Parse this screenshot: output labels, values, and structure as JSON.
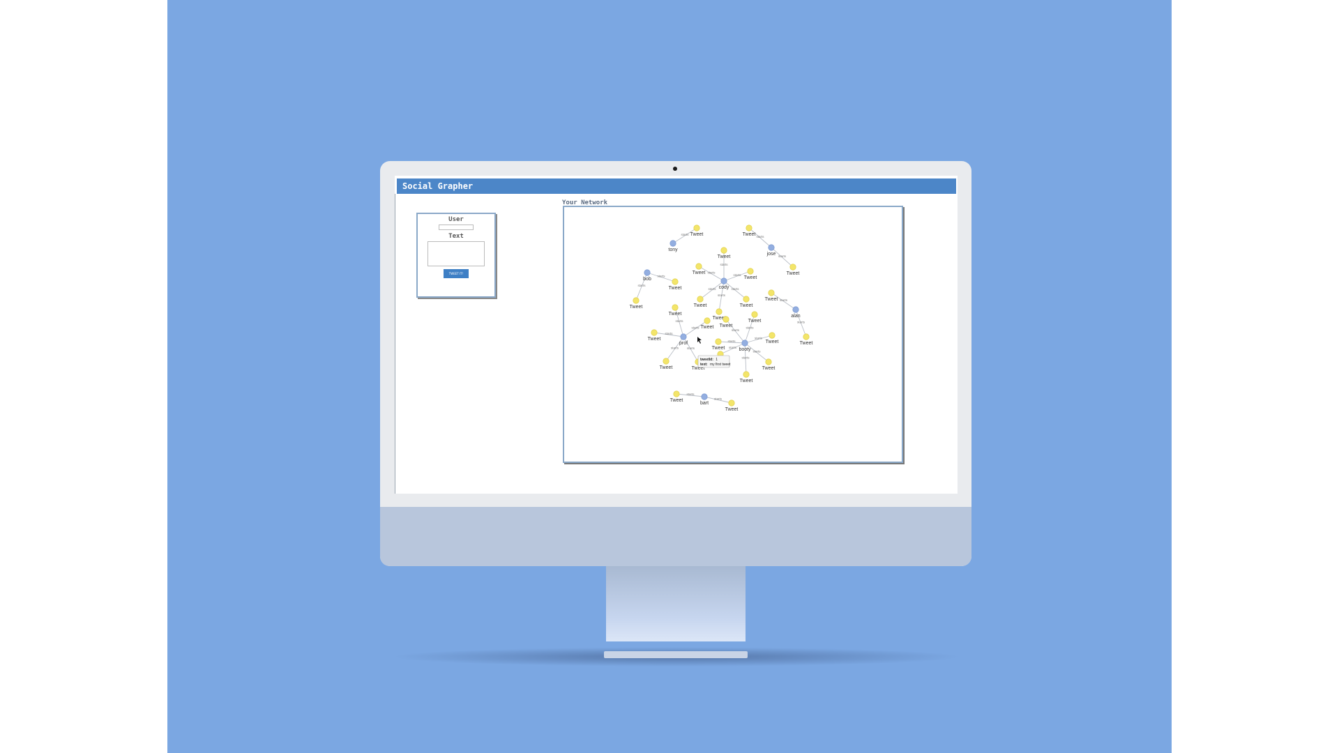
{
  "app": {
    "title": "Social Grapher"
  },
  "form": {
    "user_label": "User",
    "user_value": "",
    "text_label": "Text",
    "text_value": "",
    "submit_label": "TWEET IT!"
  },
  "network": {
    "title": "Your Network",
    "edge_label": "starts",
    "users": [
      "tony",
      "jose",
      "bob",
      "cody",
      "alan",
      "prof",
      "booty",
      "bart"
    ],
    "tweet_label": "Tweet",
    "tooltip": {
      "id_key": "tweetId:",
      "id_value": "1",
      "text_key": "text:",
      "text_value": "my first tweet"
    }
  },
  "colors": {
    "backdrop": "#7ba7e2",
    "header": "#4c86c8",
    "user_node": "#93aee0",
    "tweet_node": "#f3e56a"
  }
}
